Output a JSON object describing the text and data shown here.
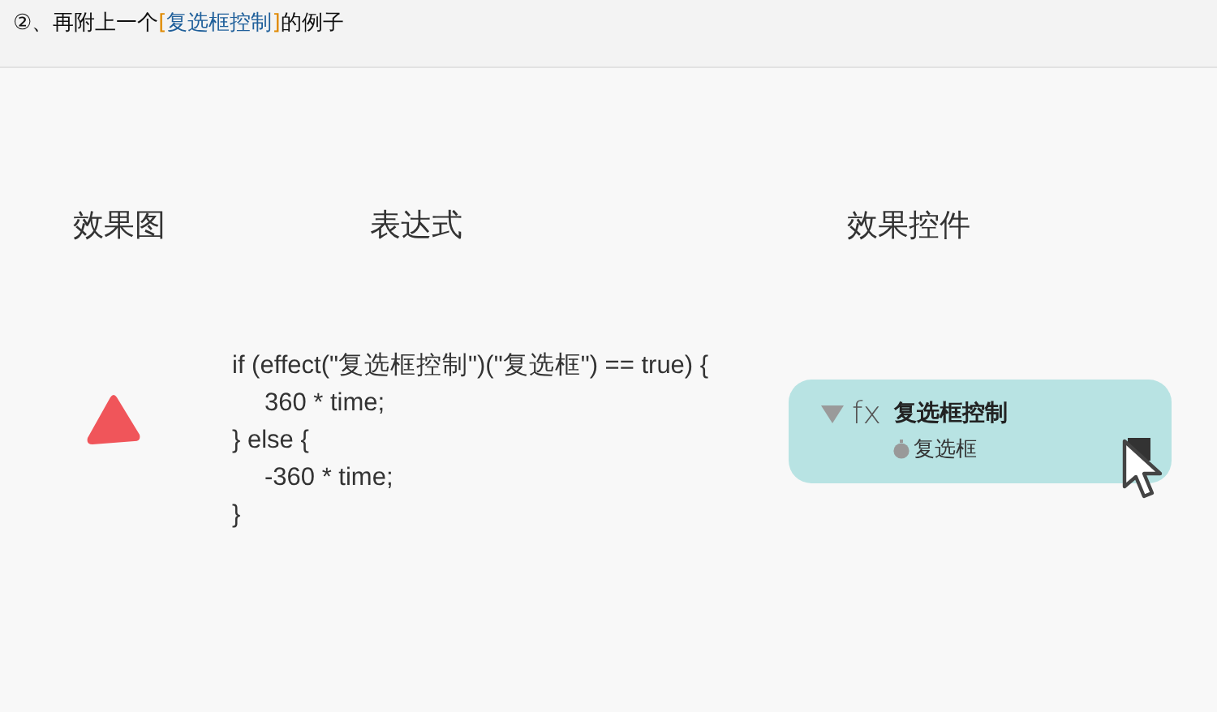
{
  "post_heading": {
    "prefix": "②、再附上一个",
    "bracket_open": "[",
    "highlight": "复选框控制",
    "bracket_close": "]",
    "suffix": "的例子"
  },
  "slide": {
    "column_titles": [
      "效果图",
      "表达式",
      "效果控件"
    ],
    "expression_lines": [
      {
        "text": "if (effect(\"复选框控制\")(\"复选框\") == true)  {",
        "children": [
          {
            "text": "360 * time;"
          }
        ]
      },
      {
        "text": "} else {",
        "children": [
          {
            "text": "-360 * time;"
          }
        ]
      },
      {
        "text": "}"
      }
    ],
    "effect_panel": {
      "expanded": true,
      "fx": "fx",
      "name": "复选框控制",
      "property": "复选框",
      "checked": true
    }
  }
}
